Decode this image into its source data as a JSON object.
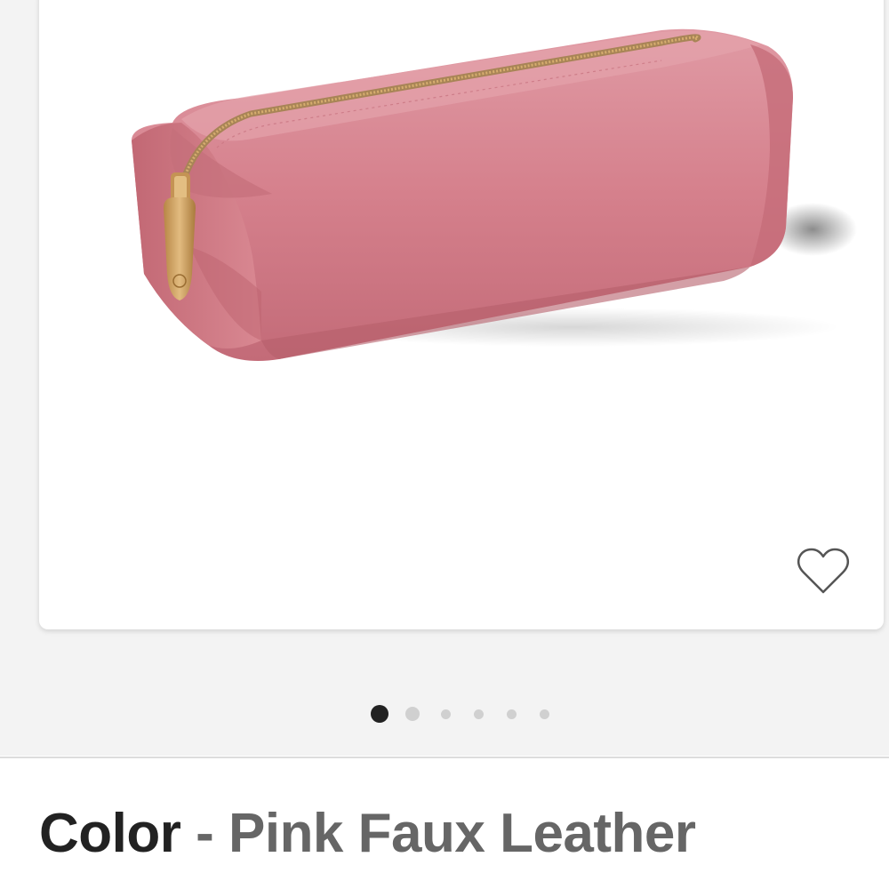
{
  "product_image": {
    "alt": "Pink faux leather pencil case with gold zipper",
    "icon": "product-photo",
    "colors": {
      "body": "#d57e8a",
      "body_shadow": "#b9606d",
      "body_highlight": "#e39aa4",
      "zipper": "#c79a5b"
    }
  },
  "favorite": {
    "icon": "heart-outline-icon",
    "color": "#555555"
  },
  "carousel": {
    "total": 6,
    "active_index": 0,
    "active_color": "#222222",
    "inactive_color": "#d0d0d0"
  },
  "variant": {
    "label": "Color",
    "separator": " - ",
    "value": "Pink Faux Leather"
  }
}
